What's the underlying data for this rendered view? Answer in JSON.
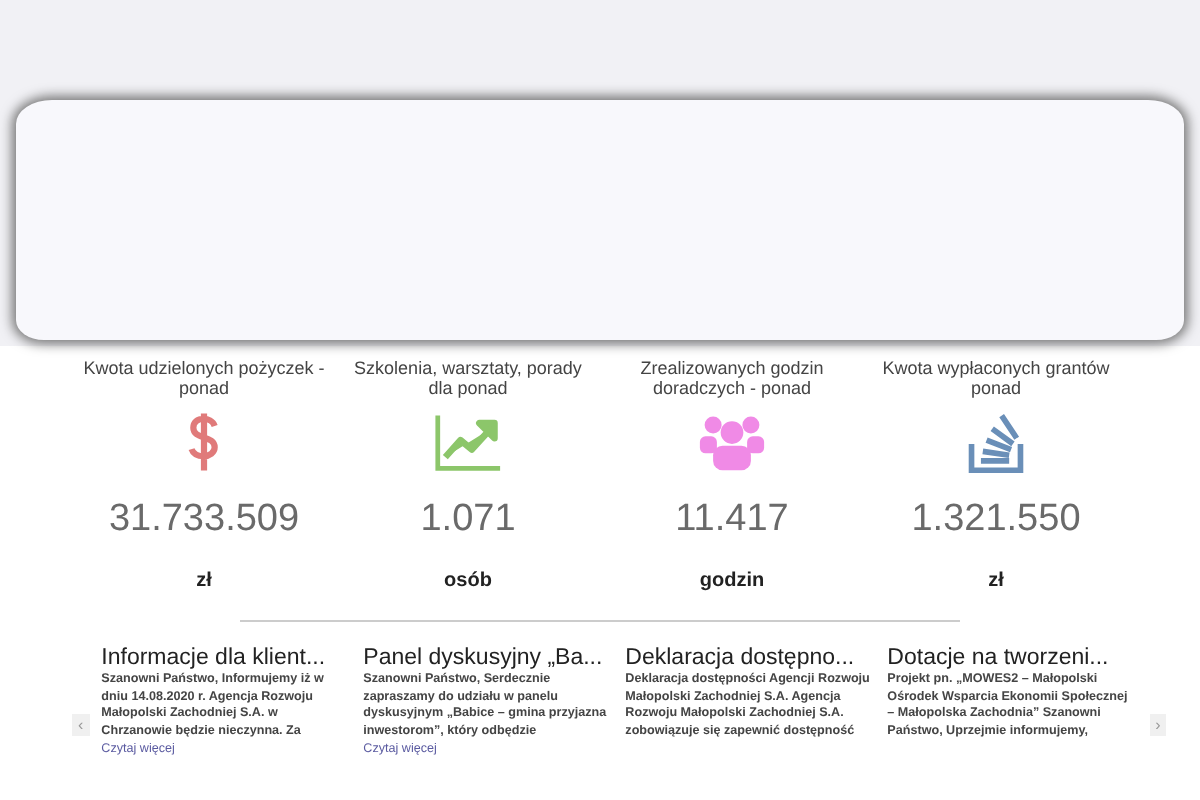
{
  "stats": [
    {
      "label": "Kwota udzielonych pożyczek - ponad",
      "kind": "dollar",
      "color": "#e07a7a",
      "value": "31.733.509",
      "unit": "zł"
    },
    {
      "label": "Szkolenia, warsztaty, porady dla ponad",
      "kind": "chart",
      "color": "#8cc66a",
      "value": "1.071",
      "unit": "osób"
    },
    {
      "label": "Zrealizowanych godzin doradczych - ponad",
      "kind": "users",
      "color": "#f08ae6",
      "value": "11.417",
      "unit": "godzin"
    },
    {
      "label": "Kwota wypłaconych grantów ponad",
      "kind": "stack",
      "color": "#6a8fb8",
      "value": "1.321.550",
      "unit": "zł"
    }
  ],
  "news": {
    "prev": "‹",
    "next": "›",
    "items": [
      {
        "title": "Informacje dla klient...",
        "text": "Szanowni Państwo, Informujemy iż w dniu 14.08.2020 r. Agencja Rozwoju Małopolski Zachodniej S.A. w Chrzanowie będzie nieczynna. Za",
        "link": "Czytaj więcej"
      },
      {
        "title": "Panel dyskusyjny „Ba...",
        "text": "Szanowni Państwo, Serdecznie zapraszamy do udziału w panelu dyskusyjnym „Babice – gmina przyjazna inwestorom”, który odbędzie",
        "link": "Czytaj więcej"
      },
      {
        "title": "Deklaracja dostępno...",
        "text": "Deklaracja dostępności Agencji Rozwoju Małopolski Zachodniej S.A. Agencja Rozwoju Małopolski Zachodniej S.A. zobowiązuje się zapewnić dostępność"
      },
      {
        "title": "Dotacje na tworzeni...",
        "text": "Projekt pn. „MOWES2 – Małopolski Ośrodek Wsparcia Ekonomii Społecznej – Małopolska Zachodnia” Szanowni Państwo, Uprzejmie informujemy,"
      }
    ]
  }
}
